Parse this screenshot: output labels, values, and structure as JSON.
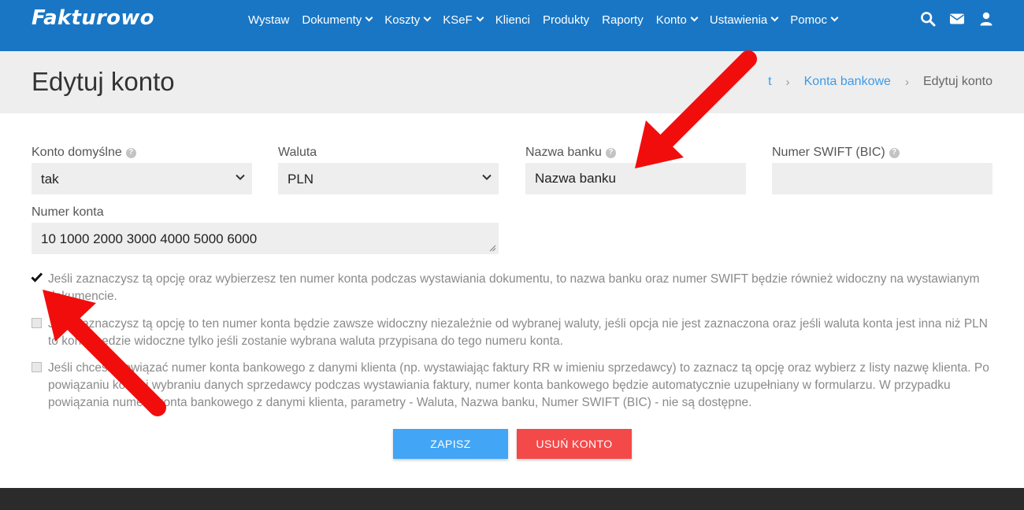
{
  "app": {
    "logo": "Fakturowo"
  },
  "nav": {
    "items": [
      {
        "label": "Wystaw",
        "dropdown": false
      },
      {
        "label": "Dokumenty",
        "dropdown": true
      },
      {
        "label": "Koszty",
        "dropdown": true
      },
      {
        "label": "KSeF",
        "dropdown": true
      },
      {
        "label": "Klienci",
        "dropdown": false
      },
      {
        "label": "Produkty",
        "dropdown": false
      },
      {
        "label": "Raporty",
        "dropdown": false
      },
      {
        "label": "Konto",
        "dropdown": true
      },
      {
        "label": "Ustawienia",
        "dropdown": true
      },
      {
        "label": "Pomoc",
        "dropdown": true
      }
    ],
    "icons": [
      "search-icon",
      "envelope-icon",
      "user-icon"
    ]
  },
  "page": {
    "title": "Edytuj konto"
  },
  "breadcrumb": {
    "partial": "t",
    "link": "Konta bankowe",
    "current": "Edytuj konto",
    "separator": "›"
  },
  "form": {
    "default_account": {
      "label": "Konto domyślne",
      "value": "tak"
    },
    "currency": {
      "label": "Waluta",
      "value": "PLN"
    },
    "bank_name": {
      "label": "Nazwa banku",
      "value": "Nazwa banku"
    },
    "swift": {
      "label": "Numer SWIFT (BIC)",
      "value": ""
    },
    "account_number": {
      "label": "Numer konta",
      "value": "10 1000 2000 3000 4000 5000 6000"
    },
    "help_glyph": "?"
  },
  "options": [
    {
      "checked": true,
      "text": "Jeśli zaznaczysz tą opcję oraz wybierzesz ten numer konta podczas wystawiania dokumentu, to nazwa banku oraz numer SWIFT będzie również widoczny na wystawianym dokumencie."
    },
    {
      "checked": false,
      "text": "Jeśli zaznaczysz tą opcję to ten numer konta będzie zawsze widoczny niezależnie od wybranej waluty, jeśli opcja nie jest zaznaczona oraz jeśli waluta konta jest inna niż PLN to konto będzie widoczne tylko jeśli zostanie wybrana waluta przypisana do tego numeru konta."
    },
    {
      "checked": false,
      "text": "Jeśli chcesz powiązać numer konta bankowego z danymi klienta (np. wystawiając faktury RR w imieniu sprzedawcy) to zaznacz tą opcję oraz wybierz z listy nazwę klienta. Po powiązaniu konta i wybraniu danych sprzedawcy podczas wystawiania faktury, numer konta bankowego będzie automatycznie uzupełniany w formularzu. W przypadku powiązania numeru konta bankowego z danymi klienta, parametry - Waluta, Nazwa banku, Numer SWIFT (BIC) - nie są dostępne."
    }
  ],
  "buttons": {
    "save": "ZAPISZ",
    "delete": "USUŃ KONTO"
  },
  "colors": {
    "navbar": "#1976c4",
    "link": "#3d9be9",
    "save": "#42a5f5",
    "delete": "#f44949",
    "annotation_arrow": "#f20d0d"
  }
}
